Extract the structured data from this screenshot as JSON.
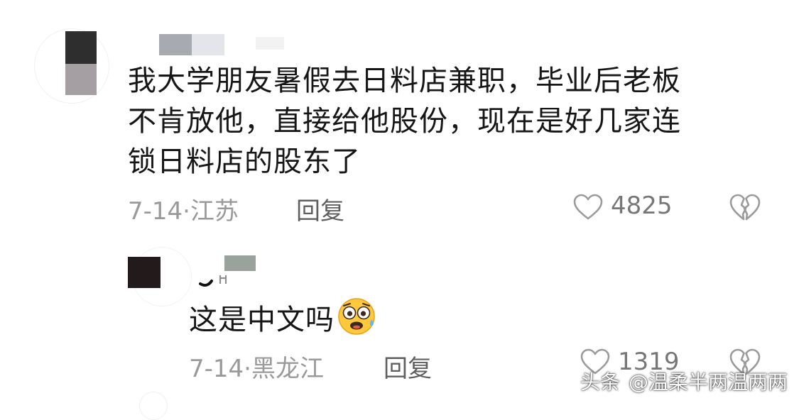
{
  "comments": [
    {
      "body_lines": [
        "我大学朋友暑假去日料店兼职，毕业后老板",
        "不肯放他，直接给他股份，现在是好几家连",
        "锁日料店的股东了"
      ],
      "date": "7-14",
      "location": "江苏",
      "reply_label": "回复",
      "like_count": "4825"
    },
    {
      "body": "这是中文吗",
      "emoji": "flushed-face-emoji",
      "date": "7-14",
      "location": "黑龙江",
      "reply_label": "回复",
      "like_count": "1319"
    }
  ],
  "watermark": {
    "platform": "头条",
    "author": "@温柔半两温两两"
  },
  "icons": {
    "like": "heart-outline-icon",
    "dislike": "broken-heart-icon"
  },
  "colors": {
    "body_text": "#161616",
    "meta_text": "#9a9a9a",
    "reply_text": "#5f5f5f",
    "icon_gray": "#9b9b9b"
  }
}
